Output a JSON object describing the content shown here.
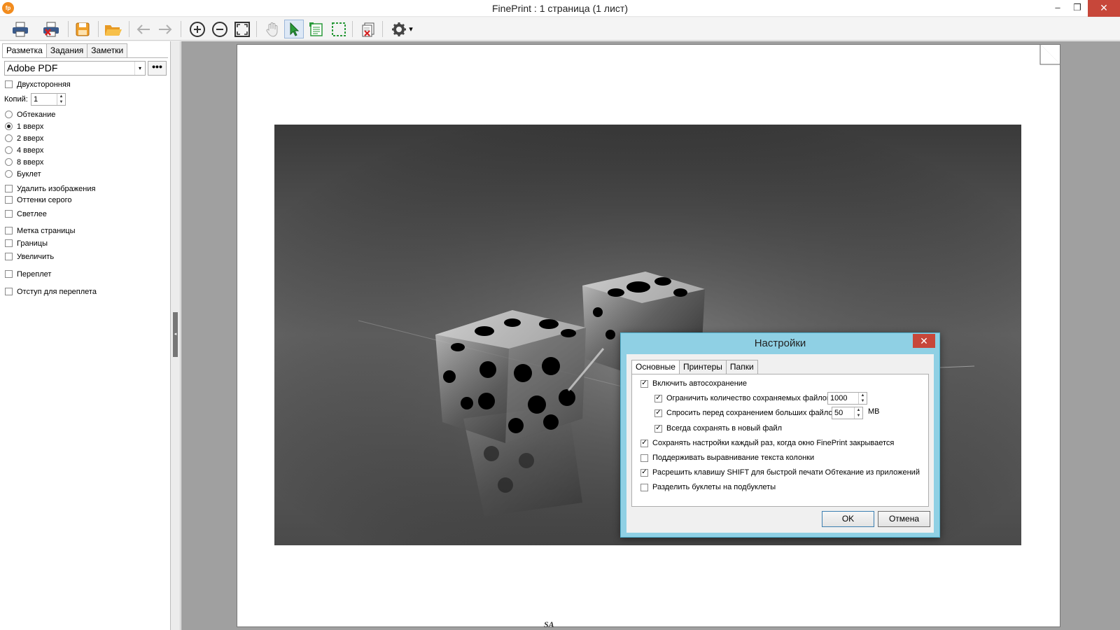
{
  "window": {
    "app_icon": "fp",
    "title": "FinePrint : 1 страница (1 лист)",
    "minimize_glyph": "–",
    "restore_glyph": "❐",
    "close_glyph": "✕"
  },
  "toolbar": {
    "icons": [
      "print-icon",
      "print-delete-icon",
      "save-icon",
      "open-folder-icon",
      "back-arrow-icon",
      "forward-arrow-icon",
      "zoom-in-icon",
      "zoom-out-icon",
      "fit-page-icon",
      "hand-icon",
      "select-arrow-icon",
      "add-notes-icon",
      "select-area-icon",
      "delete-pages-icon",
      "settings-gear-icon"
    ],
    "gear_dropdown": "▾"
  },
  "left_panel": {
    "tabs": [
      "Разметка",
      "Задания",
      "Заметки"
    ],
    "printer": "Adobe PDF",
    "printer_arrow": "▾",
    "more_button": "•••",
    "duplex": {
      "label": "Двухсторонняя",
      "checked": false
    },
    "copies_label": "Копий:",
    "copies_value": "1",
    "layout_options": [
      {
        "label": "Обтекание",
        "selected": false
      },
      {
        "label": "1 вверх",
        "selected": true
      },
      {
        "label": "2 вверх",
        "selected": false
      },
      {
        "label": "4 вверх",
        "selected": false
      },
      {
        "label": "8 вверх",
        "selected": false
      },
      {
        "label": "Буклет",
        "selected": false
      }
    ],
    "options": [
      {
        "label": "Удалить изображения",
        "checked": false
      },
      {
        "label": "Оттенки серого",
        "checked": false
      },
      {
        "label": "Светлее",
        "checked": false
      },
      {
        "label": "Метка страницы",
        "checked": false
      },
      {
        "label": "Границы",
        "checked": false
      },
      {
        "label": "Увеличить",
        "checked": false
      },
      {
        "label": "Переплет",
        "checked": false
      },
      {
        "label": "Отступ для переплета",
        "checked": false
      }
    ],
    "collapse_glyph": "◂"
  },
  "preview": {
    "footer_mark": "SA"
  },
  "dialog": {
    "title": "Настройки",
    "close_glyph": "✕",
    "tabs": [
      "Основные",
      "Принтеры",
      "Папки"
    ],
    "autosave": {
      "label": "Включить автосохранение",
      "checked": true
    },
    "limit_files": {
      "label": "Ограничить количество сохраняемых файлов",
      "checked": true,
      "value": "1000"
    },
    "ask_large": {
      "label": "Спросить перед сохранением больших файлов",
      "checked": true,
      "value": "50",
      "unit": "MB"
    },
    "always_new": {
      "label": "Всегда сохранять в новый файл",
      "checked": true
    },
    "save_settings": {
      "label": "Сохранять настройки каждый раз, когда окно FinePrint закрывается",
      "checked": true
    },
    "column_align": {
      "label": "Поддерживать выравнивание текста колонки",
      "checked": false
    },
    "shift_key": {
      "label": "Расрешить клавишу SHIFT для быстрой печати Обтекание из приложений",
      "checked": true
    },
    "split_booklets": {
      "label": "Разделить буклеты на подбуклеты",
      "checked": false
    },
    "ok_label": "OK",
    "cancel_label": "Отмена"
  }
}
